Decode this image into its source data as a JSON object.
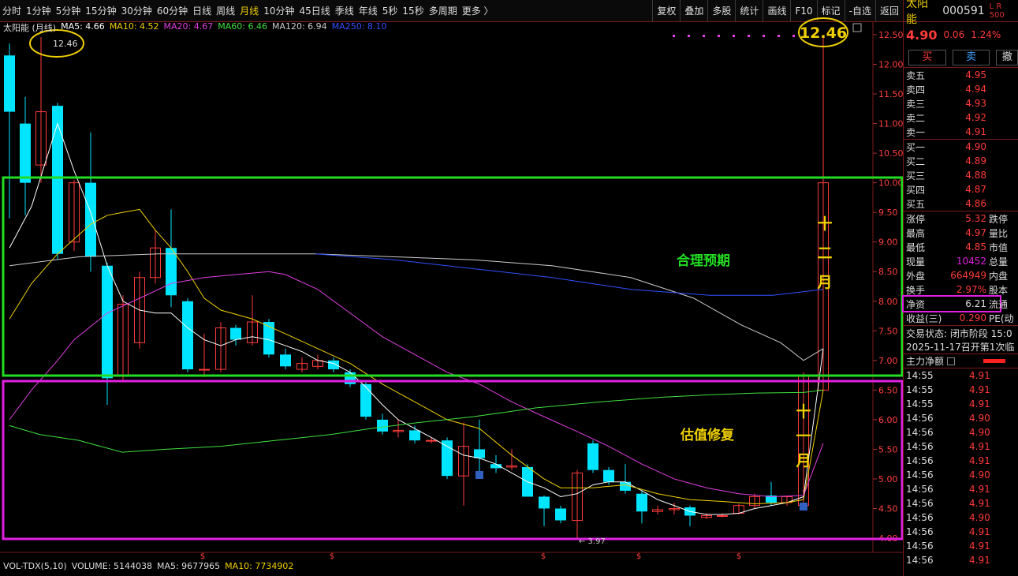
{
  "toolbar": {
    "tabs": [
      "分时",
      "1分钟",
      "5分钟",
      "15分钟",
      "30分钟",
      "60分钟",
      "日线",
      "周线",
      "月线",
      "10分钟",
      "45日线",
      "季线",
      "年线",
      "5秒",
      "15秒",
      "多周期",
      "更多 〉"
    ],
    "active_tab": "月线",
    "right_buttons": [
      "复权",
      "叠加",
      "多股",
      "统计",
      "画线",
      "F10",
      "标记",
      "-自选",
      "返回"
    ]
  },
  "main_chart": {
    "title": "太阳能 (月线)",
    "ma": [
      {
        "label": "MA5: 4.66",
        "color": "#ffffff"
      },
      {
        "label": "MA10: 4.52",
        "color": "#f0d000"
      },
      {
        "label": "MA20: 4.67",
        "color": "#e040e0"
      },
      {
        "label": "MA60: 6.46",
        "color": "#40e040"
      },
      {
        "label": "MA120: 6.94",
        "color": "#cccccc"
      },
      {
        "label": "MA250: 8.10",
        "color": "#3050ff"
      }
    ],
    "high_label": "12.46",
    "low_label": "3.97",
    "annotations": {
      "fair": "合理预期",
      "repair": "估值修复",
      "dec": "十\n二\n月",
      "nov": "十\n一\n月"
    },
    "y_ticks": [
      "12.50",
      "12.00",
      "11.50",
      "11.00",
      "10.50",
      "10.00",
      "9.50",
      "9.00",
      "8.50",
      "8.00",
      "7.50",
      "7.00",
      "6.50",
      "6.00",
      "5.50",
      "5.00",
      "4.50",
      "4.00"
    ],
    "colors": {
      "up": "#ff3b3b",
      "down": "#00e5ff",
      "fair_box": "#22dd22",
      "repair_box": "#e020e0"
    }
  },
  "volume": {
    "labels": [
      {
        "label": "VOL-TDX(5,10)",
        "color": "#dddddd"
      },
      {
        "label": "VOLUME: 5144038",
        "color": "#dddddd"
      },
      {
        "label": "MA5: 9677965",
        "color": "#dddddd"
      },
      {
        "label": "MA10: 7734902",
        "color": "#f0d000"
      }
    ]
  },
  "sidebar": {
    "name": "太阳能",
    "code": "000591",
    "mark": "L R 500",
    "price": "4.90",
    "change": "0.06",
    "pct": "1.24%",
    "btn_buy": "买",
    "btn_sell": "卖",
    "btn_other": "撤",
    "sells": [
      [
        "卖五",
        "4.95"
      ],
      [
        "卖四",
        "4.94"
      ],
      [
        "卖三",
        "4.93"
      ],
      [
        "卖二",
        "4.92"
      ],
      [
        "卖一",
        "4.91"
      ]
    ],
    "buys": [
      [
        "买一",
        "4.90"
      ],
      [
        "买二",
        "4.89"
      ],
      [
        "买三",
        "4.88"
      ],
      [
        "买四",
        "4.87"
      ],
      [
        "买五",
        "4.86"
      ]
    ],
    "stats": [
      [
        "涨停",
        "5.32",
        "跌停"
      ],
      [
        "最高",
        "4.97",
        "量比"
      ],
      [
        "最低",
        "4.85",
        "市值"
      ],
      [
        "现量",
        "10452",
        "总量"
      ],
      [
        "外盘",
        "664949",
        "内盘"
      ],
      [
        "换手",
        "2.97%",
        "股本"
      ],
      [
        "净资",
        "6.21",
        "流通"
      ],
      [
        "收益(三)",
        "0.290",
        "PE(动"
      ]
    ],
    "status": "交易状态: 闭市阶段 15:0",
    "notice": "2025-11-17召开第1次临",
    "flow_title": "主力净额",
    "trades": [
      [
        "14:55",
        "4.91"
      ],
      [
        "14:55",
        "4.91"
      ],
      [
        "14:55",
        "4.91"
      ],
      [
        "14:56",
        "4.90"
      ],
      [
        "14:56",
        "4.90"
      ],
      [
        "14:56",
        "4.91"
      ],
      [
        "14:56",
        "4.91"
      ],
      [
        "14:56",
        "4.90"
      ],
      [
        "14:56",
        "4.91"
      ],
      [
        "14:56",
        "4.91"
      ],
      [
        "14:56",
        "4.90"
      ],
      [
        "14:56",
        "4.91"
      ],
      [
        "14:56",
        "4.91"
      ],
      [
        "14:56",
        "4.91"
      ]
    ]
  }
}
